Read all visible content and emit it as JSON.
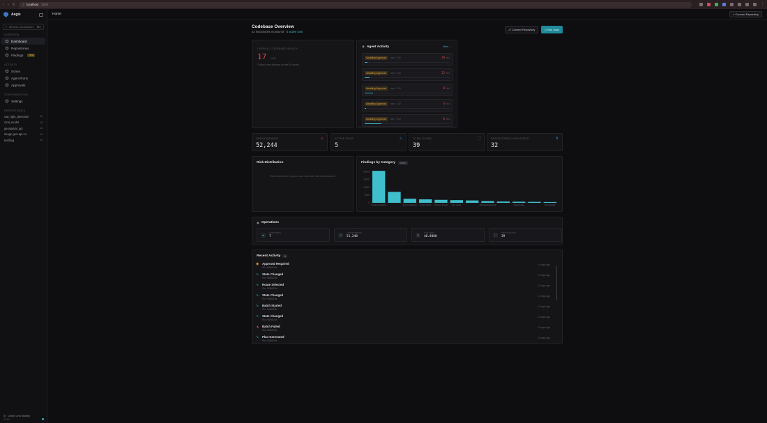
{
  "browser": {
    "host": "localhost",
    "port": ":3000"
  },
  "sidebar": {
    "brand": "Aegis",
    "search_placeholder": "Browse repositories",
    "search_hint": "⌘K",
    "sections": {
      "overview": "OVERVIEW",
      "activity": "ACTIVITY",
      "configuration": "CONFIGURATION",
      "repositories": "REPOSITORIES"
    },
    "items": [
      {
        "label": "Dashboard"
      },
      {
        "label": "Repositories"
      },
      {
        "label": "Findings",
        "badge": "New"
      },
      {
        "label": "Scans"
      },
      {
        "label": "Agent Runs"
      },
      {
        "label": "Approvals"
      },
      {
        "label": "Settings"
      }
    ],
    "repos": [
      {
        "name": "raw_light_detection",
        "count": "10"
      },
      {
        "name": "chat_model",
        "count": "10"
      },
      {
        "name": "geospatial_api",
        "count": "10"
      },
      {
        "name": "image-gen-api-v4",
        "count": "10"
      },
      {
        "name": "testblog",
        "count": "10"
      }
    ],
    "footer": {
      "status": "Online and healthy",
      "version": "v0.1.0"
    }
  },
  "topbar": {
    "crumb": "Home",
    "connect": "Connect Repository"
  },
  "header": {
    "title": "Codebase Overview",
    "subtitle_prefix": "32 repositories monitored · ",
    "subtitle_link": "5 active runs",
    "connect": "Connect Repository",
    "run_scan": "Run Scan"
  },
  "health": {
    "label": "OVERALL CODEBASE HEALTH",
    "score": "17",
    "total": "/ 100",
    "note": "Critical-level findings across 39 scans"
  },
  "agent_activity": {
    "title": "Agent Activity",
    "view": "View",
    "rows": [
      {
        "status": "Awaiting Approval",
        "step": "step · 3/10",
        "findings": "29",
        "flabel": "find",
        "progress": 0.03
      },
      {
        "status": "Awaiting Approval",
        "step": "step · 3/10",
        "findings": "22",
        "flabel": "find",
        "progress": 0.06
      },
      {
        "status": "Awaiting Approval",
        "step": "step · 3/10",
        "findings": "8",
        "flabel": "find",
        "progress": 0.1
      },
      {
        "status": "Awaiting Approval",
        "step": "step · 3/10",
        "findings": "4",
        "flabel": "find",
        "progress": 0.02
      },
      {
        "status": "Awaiting Approval",
        "step": "step · 3/10",
        "findings": "8",
        "flabel": "find",
        "progress": 0.2
      }
    ]
  },
  "stats": [
    {
      "label": "OPEN FINDINGS",
      "value": "52,244",
      "icon": "warning-icon",
      "color": "#d94b4b"
    },
    {
      "label": "ACTIVE RUNS",
      "value": "5",
      "icon": "activity-icon",
      "color": "#3f8fd9"
    },
    {
      "label": "TOTAL SCANS",
      "value": "39",
      "icon": "scan-icon",
      "color": "#8d8d96"
    },
    {
      "label": "REPOSITORIES MONITORED",
      "value": "32",
      "icon": "repo-icon",
      "color": "#3f8fd9"
    }
  ],
  "risk": {
    "title": "Risk Distribution",
    "empty": "Risk distribution requires scan data with risk classifications"
  },
  "findings_chart": {
    "title": "Findings by Category",
    "badge": "Status"
  },
  "chart_data": {
    "type": "bar",
    "title": "Findings by Category",
    "categories": [
      "Unused Variable",
      "",
      "Error Handling",
      "Import Order",
      "Unused Import",
      "Dry Code",
      "",
      "Missing Docstring",
      "",
      "Dead Code",
      "",
      "Test Quality"
    ],
    "values": [
      20500,
      7000,
      2600,
      2200,
      1900,
      1700,
      1500,
      1100,
      800,
      700,
      600,
      500
    ],
    "yticks": [
      "20000",
      "15000",
      "10000",
      "5000",
      "0"
    ],
    "ylim": [
      0,
      21000
    ],
    "color": "#3fbfcc"
  },
  "operations": {
    "title": "Operations",
    "cells": [
      {
        "label": "LOW FINDS",
        "value": "7",
        "icon": "check-icon"
      },
      {
        "label": "LOW FINDINGS",
        "value": "51,248",
        "icon": "trend-icon"
      },
      {
        "label": "LLM COST",
        "value": "$0.0000",
        "icon": "dollar-icon"
      },
      {
        "label": "TOTAL SCANS",
        "value": "39",
        "icon": "scan-icon"
      }
    ]
  },
  "recent": {
    "title": "Recent Activity",
    "badge": "14",
    "rows": [
      {
        "title": "Approval Required",
        "sub": "Run 5f086f28e",
        "time": "10 days ago",
        "icon": "alert-icon",
        "color": "#e0a040"
      },
      {
        "title": "State Changed",
        "sub": "Run 5f086f28e",
        "time": "10 days ago",
        "icon": "activity-icon",
        "color": "#3fbfcc"
      },
      {
        "title": "Route Selected",
        "sub": "Run 5f086f28e",
        "time": "10 days ago",
        "icon": "activity-icon",
        "color": "#3fbfcc"
      },
      {
        "title": "State Changed",
        "sub": "Run 5f086f28e",
        "time": "10 days ago",
        "icon": "activity-icon",
        "color": "#3fbfcc"
      },
      {
        "title": "Batch Started",
        "sub": "Run 5f086f28e",
        "time": "10 days ago",
        "icon": "activity-icon",
        "color": "#3fbfcc"
      },
      {
        "title": "State Changed",
        "sub": "Run 5f086f28e",
        "time": "10 days ago",
        "icon": "activity-icon",
        "color": "#3fbfcc"
      },
      {
        "title": "Batch Failed",
        "sub": "Run 5f086f28e",
        "time": "10 days ago",
        "icon": "error-icon",
        "color": "#d94b4b"
      },
      {
        "title": "Plan Generated",
        "sub": "Run 5f086f28e",
        "time": "10 days ago",
        "icon": "activity-icon",
        "color": "#3fbfcc"
      }
    ]
  }
}
